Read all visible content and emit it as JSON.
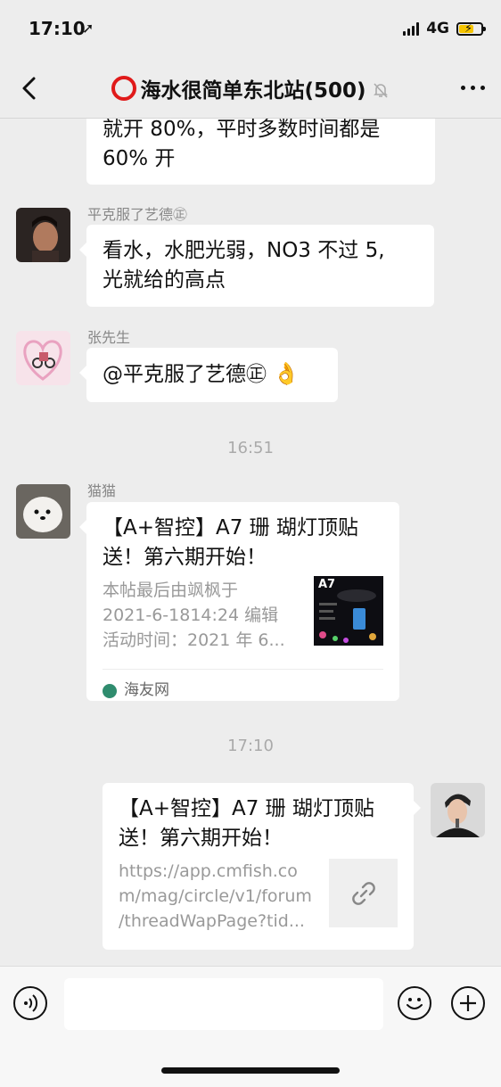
{
  "status_bar": {
    "time": "17:10",
    "location_arrow": "➚",
    "network": "4G"
  },
  "header": {
    "title": "海水很简单东北站(500)"
  },
  "messages": [
    {
      "bubble_lines": [
        "就开 80%，平时多数时间都是",
        "60% 开"
      ]
    },
    {
      "sender": "平克服了艺德㊣",
      "bubble_lines": [
        "看水，水肥光弱，NO3 不过 5,",
        "光就给的高点"
      ]
    },
    {
      "sender": "张先生",
      "text": "@平克服了艺德㊣",
      "emoji": "👌"
    }
  ],
  "timestamps": [
    "16:51",
    "17:10"
  ],
  "card_left": {
    "sender": "猫猫",
    "title_lines": [
      "【A+智控】A7 珊 瑚灯顶贴",
      "送！第六期开始！"
    ],
    "desc_lines": [
      "本帖最后由飒枫于",
      "2021-6-1814:24 编辑",
      "活动时间：2021 年 6..."
    ],
    "thumb_label": "A7",
    "source": "海友网"
  },
  "card_right": {
    "title_lines": [
      "【A+智控】A7 珊 瑚灯顶贴",
      "送！第六期开始！"
    ],
    "url_lines": [
      "https://app.cmfish.co",
      "m/mag/circle/v1/forum",
      "/threadWapPage?tid..."
    ]
  },
  "input": {
    "value": ""
  }
}
